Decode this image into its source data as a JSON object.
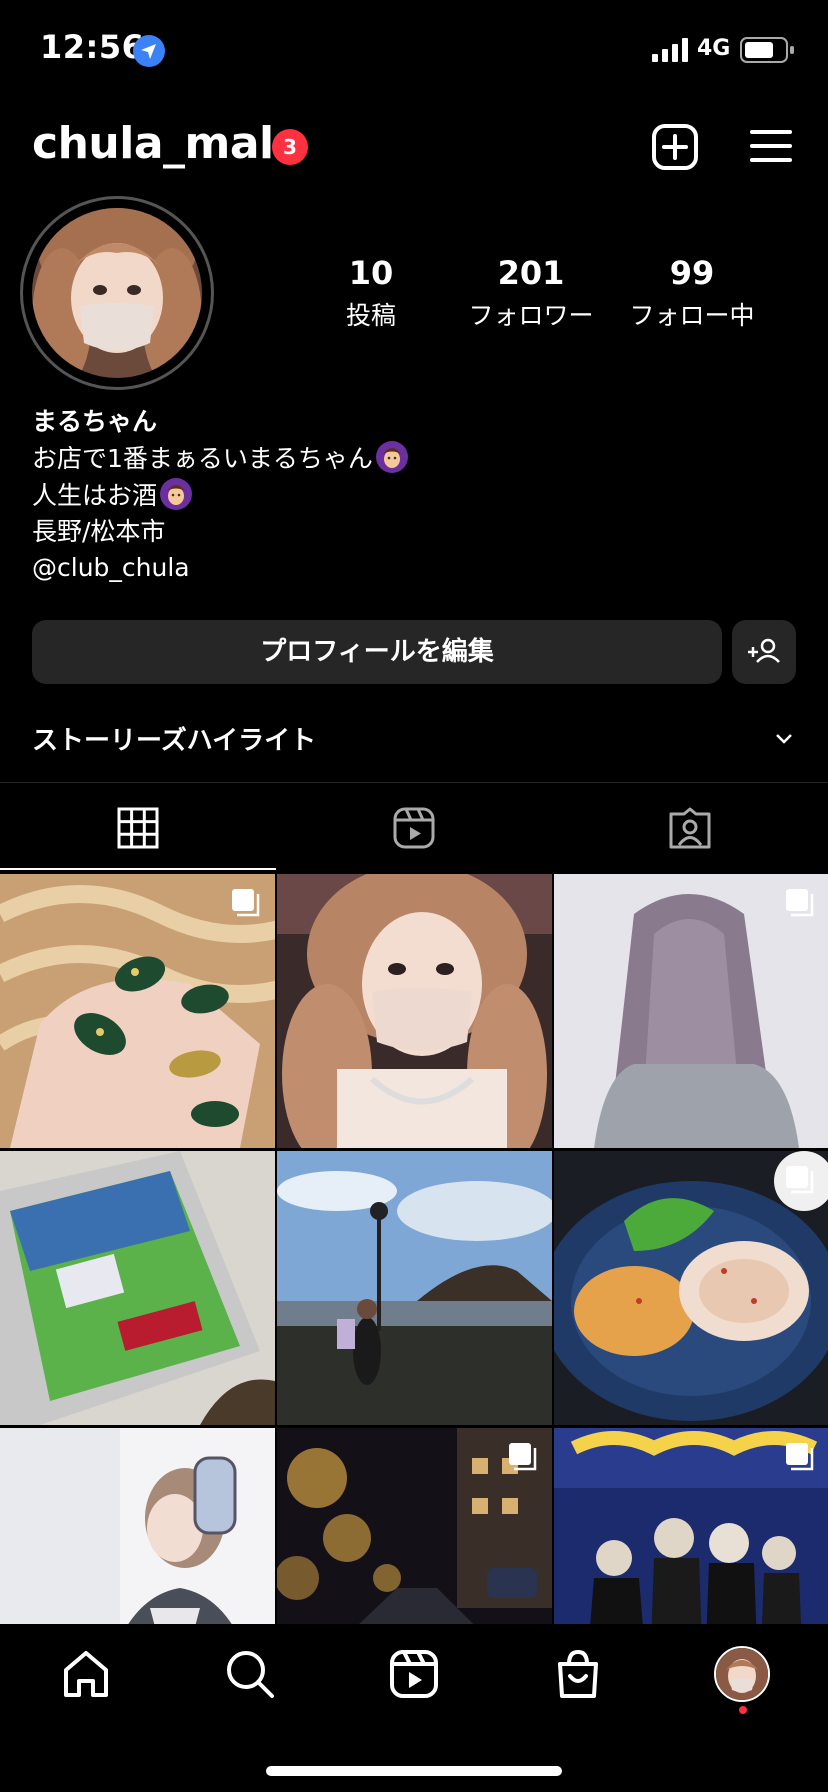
{
  "status": {
    "time": "12:56",
    "network": "4G"
  },
  "header": {
    "username": "chula_mal",
    "notification_count": "3"
  },
  "profile": {
    "stats": [
      {
        "value": "10",
        "label": "投稿"
      },
      {
        "value": "201",
        "label": "フォロワー"
      },
      {
        "value": "99",
        "label": "フォロー中"
      }
    ],
    "name": "まるちゃん",
    "bio_lines": [
      "お店で1番まぁるいまるちゃん",
      "人生はお酒",
      "長野/松本市",
      "@club_chula"
    ]
  },
  "actions": {
    "edit_profile": "プロフィールを編集"
  },
  "highlights": {
    "title": "ストーリーズハイライト"
  },
  "tabs": [
    {
      "icon": "grid-icon",
      "selected": true
    },
    {
      "icon": "reels-icon",
      "selected": false
    },
    {
      "icon": "tagged-icon",
      "selected": false
    }
  ],
  "posts": [
    {
      "subject": "nails",
      "multi": true
    },
    {
      "subject": "selfie",
      "multi": false
    },
    {
      "subject": "hair",
      "multi": true
    },
    {
      "subject": "tablet-soccer",
      "multi": false
    },
    {
      "subject": "lakeside",
      "multi": false
    },
    {
      "subject": "food",
      "multi": true
    },
    {
      "subject": "mirror-selfie",
      "multi": false
    },
    {
      "subject": "street-night",
      "multi": true
    },
    {
      "subject": "movie-poster",
      "multi": true
    }
  ],
  "bottom_nav": [
    "home-icon",
    "search-icon",
    "reels-icon",
    "shop-icon",
    "profile-avatar"
  ],
  "colors": {
    "background": "#000000",
    "button": "#262626",
    "badge": "#ff3040",
    "location": "#3b82f6"
  }
}
